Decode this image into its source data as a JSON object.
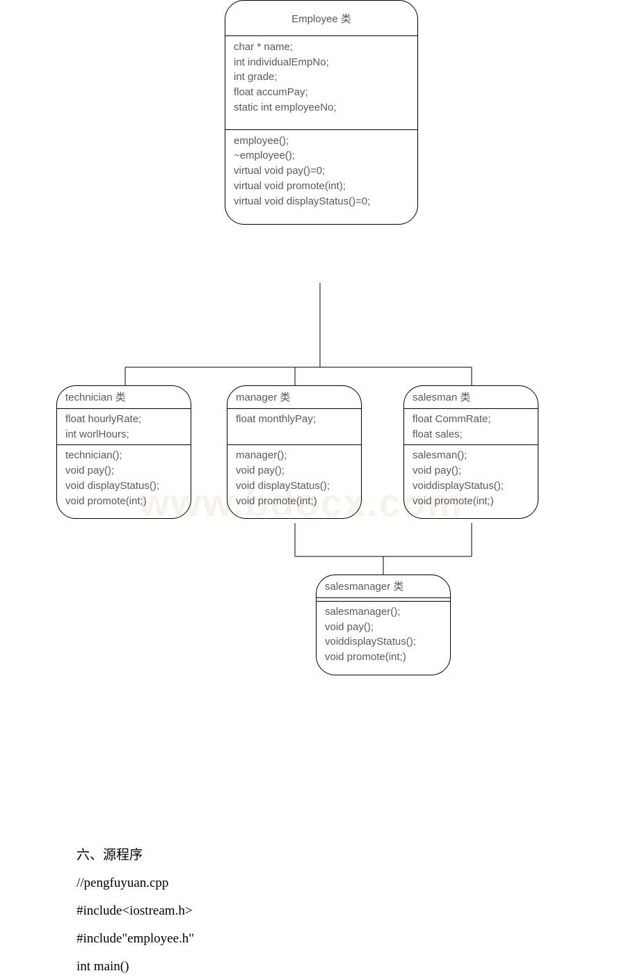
{
  "chart_data": {
    "type": "class-diagram",
    "nodes": [
      {
        "id": "employee",
        "title": "Employee 类",
        "attributes": [
          "char * name;",
          "int individualEmpNo;",
          "int grade;",
          "float accumPay;",
          "static int employeeNo;"
        ],
        "methods": [
          "employee();",
          "~employee();",
          "virtual void pay()=0;",
          "virtual void promote(int);",
          "virtual void displayStatus()=0;"
        ]
      },
      {
        "id": "technician",
        "title": "technician 类",
        "attributes": [
          "float hourlyRate;",
          "int worlHours;"
        ],
        "methods": [
          "technician();",
          "void pay();",
          "void displayStatus();",
          "void promote(int;)"
        ]
      },
      {
        "id": "manager",
        "title": "manager 类",
        "attributes": [
          "float monthlyPay;",
          ""
        ],
        "methods": [
          "manager();",
          "void pay();",
          "void displayStatus();",
          "void promote(int;)"
        ]
      },
      {
        "id": "salesman",
        "title": "salesman 类",
        "attributes": [
          "float CommRate;",
          "float sales;"
        ],
        "methods": [
          "salesman();",
          "void pay();",
          "voiddisplayStatus();",
          "void promote(int;)"
        ]
      },
      {
        "id": "salesmanager",
        "title": "salesmanager 类",
        "attributes_empty": true,
        "methods": [
          "salesmanager();",
          "void pay();",
          "voiddisplayStatus();",
          "void promote(int;)"
        ]
      }
    ],
    "edges": [
      [
        "employee",
        "technician"
      ],
      [
        "employee",
        "manager"
      ],
      [
        "employee",
        "salesman"
      ],
      [
        "manager",
        "salesmanager"
      ],
      [
        "salesman",
        "salesmanager"
      ]
    ]
  },
  "text": {
    "heading": "六、源程序",
    "lines": [
      " //pengfuyuan.cpp",
      "#include<iostream.h>",
      "#include\"employee.h\"",
      "int main()"
    ]
  },
  "watermark": "www.bdocx.com"
}
